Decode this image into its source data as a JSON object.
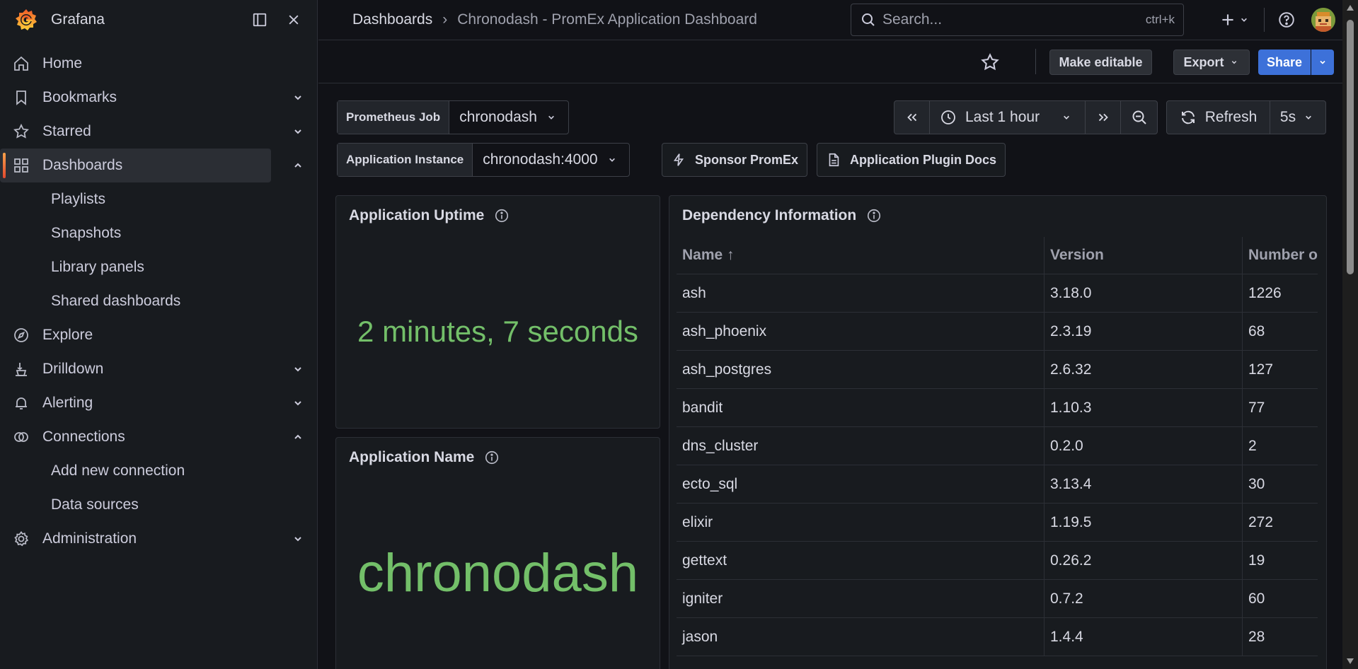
{
  "app": {
    "name": "Grafana"
  },
  "sidebar": {
    "items": [
      {
        "label": "Home",
        "icon": "home-icon",
        "chevron": ""
      },
      {
        "label": "Bookmarks",
        "icon": "bookmark-icon",
        "chevron": "down"
      },
      {
        "label": "Starred",
        "icon": "star-icon",
        "chevron": "down"
      },
      {
        "label": "Dashboards",
        "icon": "apps-icon",
        "chevron": "up",
        "active": true
      },
      {
        "label": "Explore",
        "icon": "compass-icon",
        "chevron": ""
      },
      {
        "label": "Drilldown",
        "icon": "drilldown-icon",
        "chevron": "down"
      },
      {
        "label": "Alerting",
        "icon": "bell-icon",
        "chevron": "down"
      },
      {
        "label": "Connections",
        "icon": "connections-icon",
        "chevron": "up"
      },
      {
        "label": "Administration",
        "icon": "cog-icon",
        "chevron": "down"
      }
    ],
    "dashboards_children": [
      "Playlists",
      "Snapshots",
      "Library panels",
      "Shared dashboards"
    ],
    "connections_children": [
      "Add new connection",
      "Data sources"
    ]
  },
  "topbar": {
    "breadcrumb_root": "Dashboards",
    "breadcrumb_current": "Chronodash - PromEx Application Dashboard",
    "search_placeholder": "Search...",
    "search_shortcut": "ctrl+k"
  },
  "toolbar": {
    "make_editable": "Make editable",
    "export": "Export",
    "share": "Share"
  },
  "variables": {
    "job_label": "Prometheus Job",
    "job_value": "chronodash",
    "instance_label": "Application Instance",
    "instance_value": "chronodash:4000"
  },
  "links": {
    "sponsor": "Sponsor PromEx",
    "docs": "Application Plugin Docs"
  },
  "time": {
    "range": "Last 1 hour",
    "refresh": "Refresh",
    "interval": "5s"
  },
  "panels": {
    "uptime": {
      "title": "Application Uptime",
      "value": "2 minutes, 7 seconds"
    },
    "name": {
      "title": "Application Name",
      "value": "chronodash"
    },
    "deps": {
      "title": "Dependency Information",
      "columns": [
        "Name ↑",
        "Version",
        "Number o"
      ],
      "rows": [
        [
          "ash",
          "3.18.0",
          "1226"
        ],
        [
          "ash_phoenix",
          "2.3.19",
          "68"
        ],
        [
          "ash_postgres",
          "2.6.32",
          "127"
        ],
        [
          "bandit",
          "1.10.3",
          "77"
        ],
        [
          "dns_cluster",
          "0.2.0",
          "2"
        ],
        [
          "ecto_sql",
          "3.13.4",
          "30"
        ],
        [
          "elixir",
          "1.19.5",
          "272"
        ],
        [
          "gettext",
          "0.26.2",
          "19"
        ],
        [
          "igniter",
          "0.7.2",
          "60"
        ],
        [
          "jason",
          "1.4.4",
          "28"
        ]
      ]
    }
  },
  "colors": {
    "accent_green": "#73bf69",
    "primary_blue": "#3d71d9",
    "brand_orange": "#f46800"
  }
}
